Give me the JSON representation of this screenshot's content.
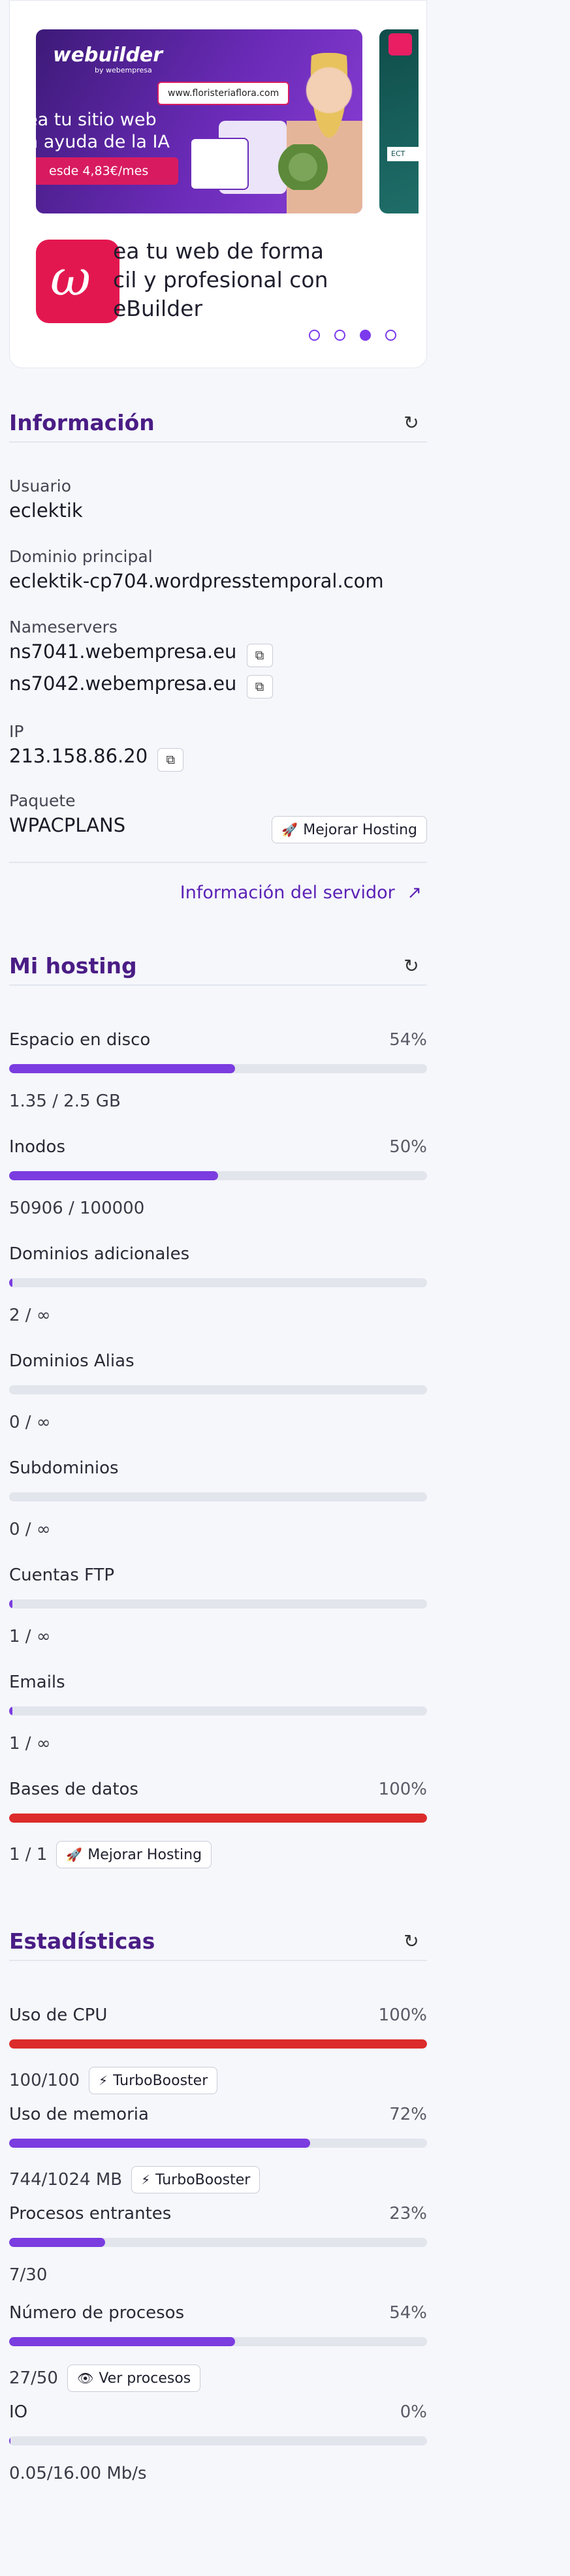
{
  "banner": {
    "brand": "webuilder",
    "brand_sub": "by webempresa",
    "url": "www.floristeriaflora.com",
    "headline": "ea tu sitio web\nn ayuda de la IA",
    "price": "esde 4,83€/mes",
    "side_text": "ECT",
    "app_icon_glyph": "ω",
    "promo_text": "ea tu web de forma\ncil y profesional con\neBuilder",
    "active_dot": 2,
    "dot_count": 4,
    "accent": "#7c3aed",
    "icon_color": "#e3174f"
  },
  "informacion": {
    "title": "Información",
    "refresh_icon": "refresh-icon",
    "usuario_label": "Usuario",
    "usuario": "eclektik",
    "dominio_label": "Dominio principal",
    "dominio": "eclektik-cp704.wordpresstemporal.com",
    "nameservers_label": "Nameservers",
    "ns1": "ns7041.webempresa.eu",
    "ns2": "ns7042.webempresa.eu",
    "ip_label": "IP",
    "ip": "213.158.86.20",
    "paquete_label": "Paquete",
    "paquete": "WPACPLANS",
    "mejorar_label": "Mejorar Hosting",
    "servidor_link": "Información del servidor"
  },
  "hosting": {
    "title": "Mi hosting",
    "items": [
      {
        "label": "Espacio en disco",
        "pct_text": "54%",
        "fill": 0.54,
        "sub": "1.35 / 2.5 GB",
        "color": "#7b3ce0"
      },
      {
        "label": "Inodos",
        "pct_text": "50%",
        "fill": 0.5,
        "sub": "50906 / 100000",
        "color": "#7b3ce0"
      },
      {
        "label": "Dominios adicionales",
        "pct_text": "",
        "fill": 0.008,
        "sub": "2 / ∞",
        "color": "#7b3ce0"
      },
      {
        "label": "Dominios Alias",
        "pct_text": "",
        "fill": 0,
        "sub": "0 / ∞",
        "color": "#7b3ce0"
      },
      {
        "label": "Subdominios",
        "pct_text": "",
        "fill": 0,
        "sub": "0 / ∞",
        "color": "#7b3ce0"
      },
      {
        "label": "Cuentas FTP",
        "pct_text": "",
        "fill": 0.008,
        "sub": "1 / ∞",
        "color": "#7b3ce0"
      },
      {
        "label": "Emails",
        "pct_text": "",
        "fill": 0.008,
        "sub": "1 / ∞",
        "color": "#7b3ce0"
      },
      {
        "label": "Bases de datos",
        "pct_text": "100%",
        "fill": 1.0,
        "sub": "1 / 1",
        "color": "#dc2b2b",
        "button": "Mejorar Hosting",
        "button_icon": "rocket-icon"
      }
    ]
  },
  "estadisticas": {
    "title": "Estadísticas",
    "items": [
      {
        "label": "Uso de CPU",
        "pct_text": "100%",
        "fill": 1.0,
        "sub": "100/100",
        "color": "#dc2b2b",
        "button": "TurboBooster",
        "button_icon": "bolt-icon"
      },
      {
        "label": "Uso de memoria",
        "pct_text": "72%",
        "fill": 0.72,
        "sub": "744/1024 MB",
        "color": "#7b3ce0",
        "button": "TurboBooster",
        "button_icon": "bolt-icon"
      },
      {
        "label": "Procesos entrantes",
        "pct_text": "23%",
        "fill": 0.23,
        "sub": "7/30",
        "color": "#7b3ce0"
      },
      {
        "label": "Número de procesos",
        "pct_text": "54%",
        "fill": 0.54,
        "sub": "27/50",
        "color": "#7b3ce0",
        "button": "Ver procesos",
        "button_icon": "eye-icon"
      },
      {
        "label": "IO",
        "pct_text": "0%",
        "fill": 0.003,
        "sub": "0.05/16.00 Mb/s",
        "color": "#7b3ce0"
      }
    ]
  }
}
